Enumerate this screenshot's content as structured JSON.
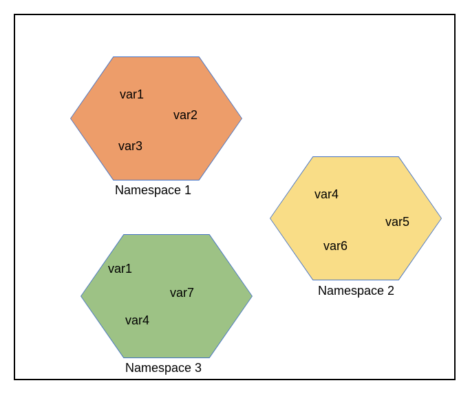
{
  "namespaces": [
    {
      "name": "Namespace 1",
      "vars": [
        "var1",
        "var2",
        "var3"
      ],
      "fill": "#ED9D6A"
    },
    {
      "name": "Namespace 2",
      "vars": [
        "var4",
        "var5",
        "var6"
      ],
      "fill": "#F9DD87"
    },
    {
      "name": "Namespace 3",
      "vars": [
        "var1",
        "var7",
        "var4"
      ],
      "fill": "#9DC285"
    }
  ]
}
